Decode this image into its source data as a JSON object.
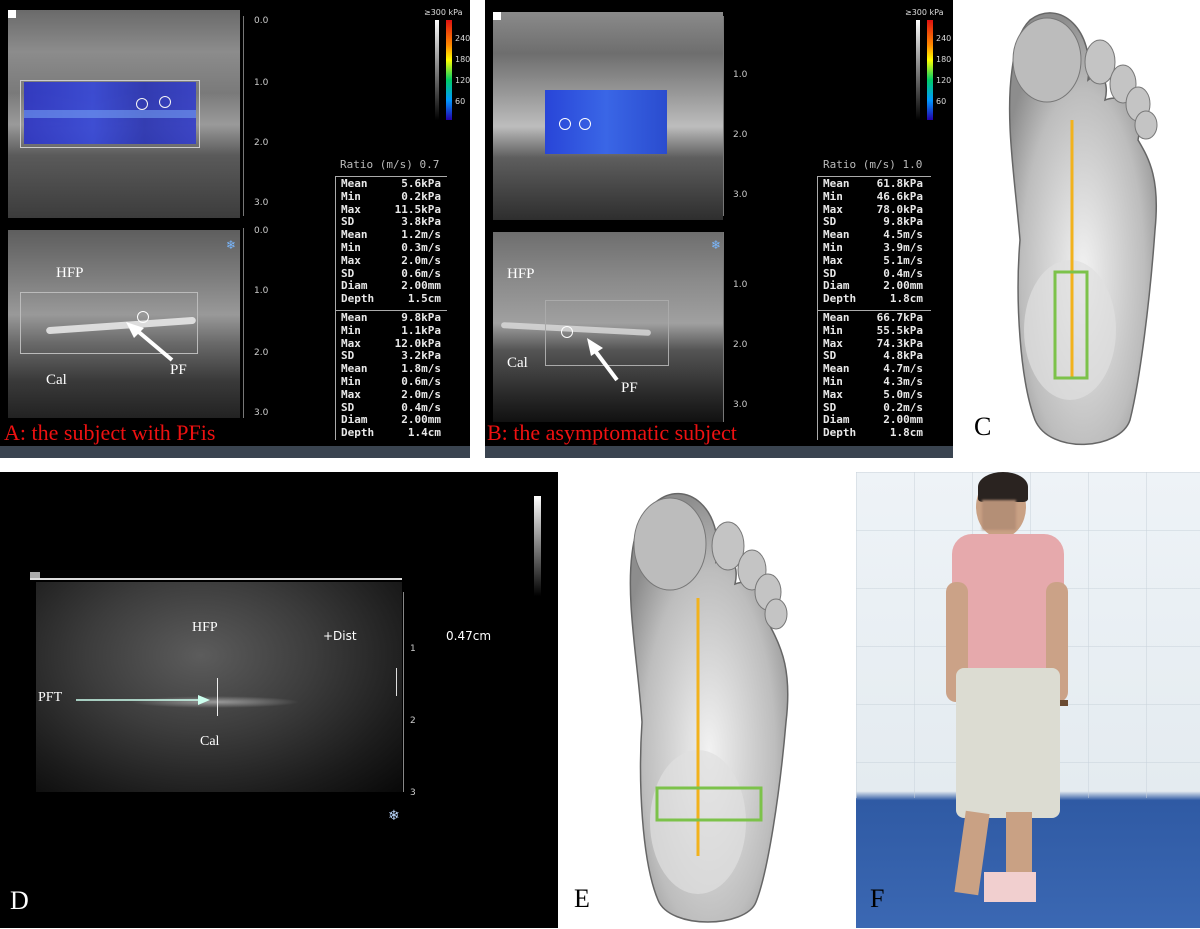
{
  "panels": {
    "a": {
      "caption": "A: the subject with PFis",
      "ratio": "Ratio (m/s) 0.7",
      "depth_top": [
        "0.0",
        "1.0",
        "2.0",
        "3.0"
      ],
      "depth_bottom": [
        "0.0",
        "1.0",
        "2.0",
        "3.0"
      ],
      "colorbar": [
        "≥300 kPa",
        "240",
        "180",
        "120",
        "60"
      ],
      "stats1": [
        [
          "Mean",
          "5.6kPa"
        ],
        [
          "Min",
          "0.2kPa"
        ],
        [
          "Max",
          "11.5kPa"
        ],
        [
          "SD",
          "3.8kPa"
        ],
        [
          "Mean",
          "1.2m/s"
        ],
        [
          "Min",
          "0.3m/s"
        ],
        [
          "Max",
          "2.0m/s"
        ],
        [
          "SD",
          "0.6m/s"
        ],
        [
          "Diam",
          "2.00mm"
        ],
        [
          "Depth",
          "1.5cm"
        ]
      ],
      "stats2": [
        [
          "Mean",
          "9.8kPa"
        ],
        [
          "Min",
          "1.1kPa"
        ],
        [
          "Max",
          "12.0kPa"
        ],
        [
          "SD",
          "3.2kPa"
        ],
        [
          "Mean",
          "1.8m/s"
        ],
        [
          "Min",
          "0.6m/s"
        ],
        [
          "Max",
          "2.0m/s"
        ],
        [
          "SD",
          "0.4m/s"
        ],
        [
          "Diam",
          "2.00mm"
        ],
        [
          "Depth",
          "1.4cm"
        ]
      ],
      "labels": {
        "hfp": "HFP",
        "cal": "Cal",
        "pf": "PF"
      }
    },
    "b": {
      "caption": "B: the asymptomatic subject",
      "ratio": "Ratio (m/s) 1.0",
      "depth_top": [
        "1.0",
        "2.0",
        "3.0"
      ],
      "depth_bottom": [
        "1.0",
        "2.0",
        "3.0"
      ],
      "colorbar": [
        "≥300 kPa",
        "240",
        "180",
        "120",
        "60"
      ],
      "stats1": [
        [
          "Mean",
          "61.8kPa"
        ],
        [
          "Min",
          "46.6kPa"
        ],
        [
          "Max",
          "78.0kPa"
        ],
        [
          "SD",
          "9.8kPa"
        ],
        [
          "Mean",
          "4.5m/s"
        ],
        [
          "Min",
          "3.9m/s"
        ],
        [
          "Max",
          "5.1m/s"
        ],
        [
          "SD",
          "0.4m/s"
        ],
        [
          "Diam",
          "2.00mm"
        ],
        [
          "Depth",
          "1.8cm"
        ]
      ],
      "stats2": [
        [
          "Mean",
          "66.7kPa"
        ],
        [
          "Min",
          "55.5kPa"
        ],
        [
          "Max",
          "74.3kPa"
        ],
        [
          "SD",
          "4.8kPa"
        ],
        [
          "Mean",
          "4.7m/s"
        ],
        [
          "Min",
          "4.3m/s"
        ],
        [
          "Max",
          "5.0m/s"
        ],
        [
          "SD",
          "0.2m/s"
        ],
        [
          "Diam",
          "2.00mm"
        ],
        [
          "Depth",
          "1.8cm"
        ]
      ],
      "labels": {
        "hfp": "HFP",
        "cal": "Cal",
        "pf": "PF"
      }
    },
    "c": {
      "letter": "C"
    },
    "d": {
      "letter": "D",
      "labels": {
        "hfp": "HFP",
        "pft": "PFT",
        "cal": "Cal",
        "dist": "+Dist",
        "measure": "0.47cm"
      },
      "depth": [
        "1",
        "2",
        "3"
      ]
    },
    "e": {
      "letter": "E"
    },
    "f": {
      "letter": "F"
    }
  },
  "colors": {
    "caption_red": "#e11111",
    "plantar_line": "#f2b21c",
    "roi_box": "#7cc24a",
    "elasto_blue": "#2a3fcf"
  }
}
